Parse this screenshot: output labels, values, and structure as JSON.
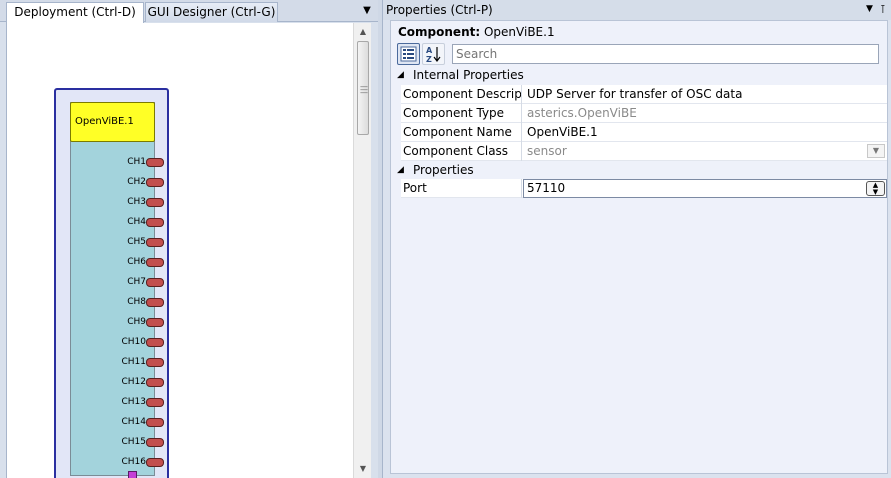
{
  "left_panel": {
    "tabs": [
      {
        "label": "Deployment (Ctrl-D)",
        "active": true
      },
      {
        "label": "GUI Designer (Ctrl-G)",
        "active": false
      }
    ],
    "component": {
      "title": "OpenViBE.1",
      "ports": [
        "CH1",
        "CH2",
        "CH3",
        "CH4",
        "CH5",
        "CH6",
        "CH7",
        "CH8",
        "CH9",
        "CH10",
        "CH11",
        "CH12",
        "CH13",
        "CH14",
        "CH15",
        "CH16"
      ]
    },
    "icons": {
      "dropdown": "chevron-down-icon",
      "scroll_up": "arrow-up-icon",
      "scroll_down": "arrow-down-icon",
      "event_port": "event-output-icon"
    }
  },
  "properties_panel": {
    "title": "Properties (Ctrl-P)",
    "component_label": "Component:",
    "component_name": "OpenViBE.1",
    "search_placeholder": "Search",
    "sections": {
      "internal": {
        "label": "Internal Properties",
        "rows": [
          {
            "name": "Component Descriptic",
            "value": "UDP Server for transfer of OSC data",
            "readonly": false
          },
          {
            "name": "Component Type",
            "value": "asterics.OpenViBE",
            "readonly": true
          },
          {
            "name": "Component Name",
            "value": "OpenViBE.1",
            "readonly": false
          },
          {
            "name": "Component Class",
            "value": "sensor",
            "readonly": true
          }
        ]
      },
      "properties": {
        "label": "Properties",
        "rows": [
          {
            "name": "Port",
            "value": "57110"
          }
        ]
      }
    },
    "icons": {
      "categorized": "categorized-view-icon",
      "alphabetical": "sort-az-icon",
      "dropdown": "chevron-down-icon",
      "pin": "pin-icon"
    }
  },
  "colors": {
    "component_border": "#2a2fa0",
    "component_body": "#a3d3dc",
    "component_title": "#ffff26",
    "port_pin": "#c24e4e",
    "event_pin": "#c43fd6"
  }
}
